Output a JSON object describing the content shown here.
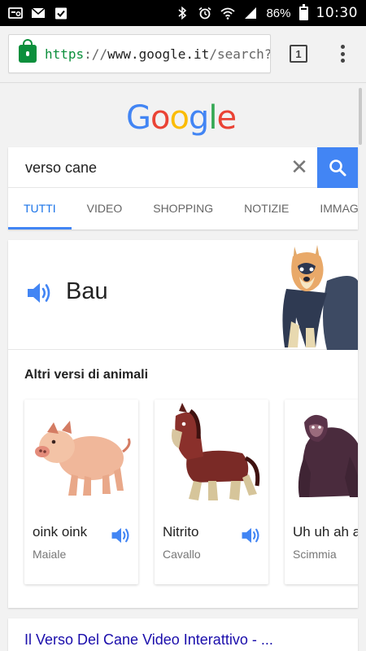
{
  "status_bar": {
    "battery": "86%",
    "time": "10:30"
  },
  "browser": {
    "url_scheme": "https",
    "url_sep": "://",
    "url_host": "www.google.it",
    "url_path": "/search?q=",
    "tab_count": "1"
  },
  "logo_letters": [
    "G",
    "o",
    "o",
    "g",
    "l",
    "e"
  ],
  "search": {
    "query": "verso cane",
    "clear_glyph": "✕"
  },
  "tabs": [
    {
      "label": "TUTTI",
      "active": true
    },
    {
      "label": "VIDEO",
      "active": false
    },
    {
      "label": "SHOPPING",
      "active": false
    },
    {
      "label": "NOTIZIE",
      "active": false
    },
    {
      "label": "IMMAGINI",
      "active": false
    }
  ],
  "answer": {
    "word": "Bau"
  },
  "other_sounds": {
    "title": "Altri versi di animali",
    "items": [
      {
        "sound": "oink oink",
        "name": "Maiale"
      },
      {
        "sound": "Nitrito",
        "name": "Cavallo"
      },
      {
        "sound": "Uh uh ah ah",
        "name": "Scimmia"
      }
    ]
  },
  "result": {
    "title": "Il Verso Del Cane Video Interattivo - ..."
  },
  "colors": {
    "accent": "#4285f4",
    "link": "#1a0dab",
    "secure": "#0b8f3c"
  }
}
